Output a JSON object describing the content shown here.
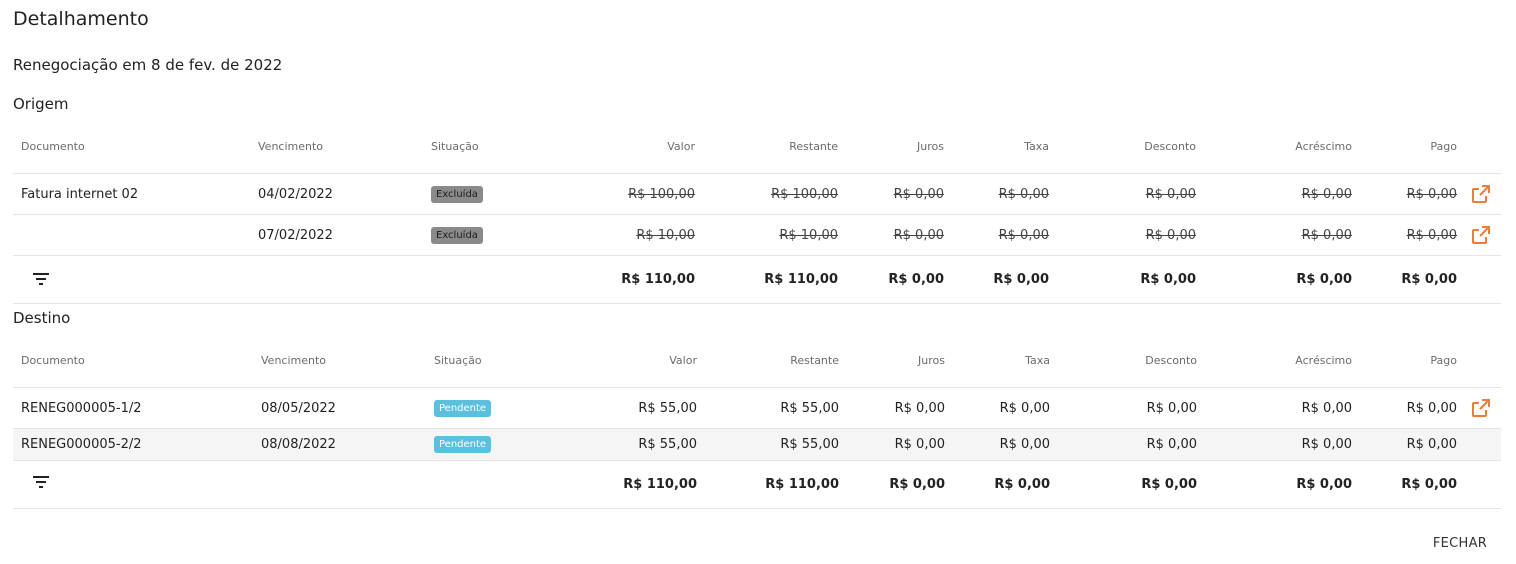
{
  "dialog": {
    "title": "Detalhamento",
    "subtitle": "Renegociação em 8 de fev. de 2022",
    "close_label": "FECHAR"
  },
  "columns": [
    "Documento",
    "Vencimento",
    "Situação",
    "Valor",
    "Restante",
    "Juros",
    "Taxa",
    "Desconto",
    "Acréscimo",
    "Pago"
  ],
  "colors": {
    "accent_icon": "#ef7b3a",
    "badge_excluida": "#8a8a8a",
    "badge_pendente": "#5bc0de"
  },
  "origem": {
    "label": "Origem",
    "rows": [
      {
        "documento": "Fatura internet 02",
        "vencimento": "04/02/2022",
        "situacao": "Excluída",
        "valor": "R$ 100,00",
        "restante": "R$ 100,00",
        "juros": "R$ 0,00",
        "taxa": "R$ 0,00",
        "desconto": "R$ 0,00",
        "acrescimo": "R$ 0,00",
        "pago": "R$ 0,00"
      },
      {
        "documento": "",
        "vencimento": "07/02/2022",
        "situacao": "Excluída",
        "valor": "R$ 10,00",
        "restante": "R$ 10,00",
        "juros": "R$ 0,00",
        "taxa": "R$ 0,00",
        "desconto": "R$ 0,00",
        "acrescimo": "R$ 0,00",
        "pago": "R$ 0,00"
      }
    ],
    "totals": {
      "valor": "R$ 110,00",
      "restante": "R$ 110,00",
      "juros": "R$ 0,00",
      "taxa": "R$ 0,00",
      "desconto": "R$ 0,00",
      "acrescimo": "R$ 0,00",
      "pago": "R$ 0,00"
    }
  },
  "destino": {
    "label": "Destino",
    "rows": [
      {
        "documento": "RENEG000005-1/2",
        "vencimento": "08/05/2022",
        "situacao": "Pendente",
        "valor": "R$ 55,00",
        "restante": "R$ 55,00",
        "juros": "R$ 0,00",
        "taxa": "R$ 0,00",
        "desconto": "R$ 0,00",
        "acrescimo": "R$ 0,00",
        "pago": "R$ 0,00"
      },
      {
        "documento": "RENEG000005-2/2",
        "vencimento": "08/08/2022",
        "situacao": "Pendente",
        "valor": "R$ 55,00",
        "restante": "R$ 55,00",
        "juros": "R$ 0,00",
        "taxa": "R$ 0,00",
        "desconto": "R$ 0,00",
        "acrescimo": "R$ 0,00",
        "pago": "R$ 0,00"
      }
    ],
    "totals": {
      "valor": "R$ 110,00",
      "restante": "R$ 110,00",
      "juros": "R$ 0,00",
      "taxa": "R$ 0,00",
      "desconto": "R$ 0,00",
      "acrescimo": "R$ 0,00",
      "pago": "R$ 0,00"
    }
  }
}
